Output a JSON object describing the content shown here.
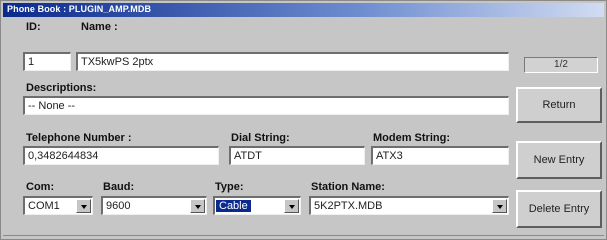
{
  "window": {
    "title": "Phone Book : PLUGIN_AMP.MDB"
  },
  "labels": {
    "id": "ID:",
    "name": "Name :",
    "descriptions": "Descriptions:",
    "telephone": "Telephone Number :",
    "dial": "Dial String:",
    "modem": "Modem String:",
    "com": "Com:",
    "baud": "Baud:",
    "type": "Type:",
    "station": "Station Name:"
  },
  "fields": {
    "id": "1",
    "name": "TX5kwPS 2ptx",
    "descriptions": "-- None --",
    "telephone": "0,3482644834",
    "dial": "ATDT",
    "modem": "ATX3",
    "com": "COM1",
    "baud": "9600",
    "type": "Cable",
    "station": "5K2PTX.MDB"
  },
  "record_counter": "1/2",
  "buttons": {
    "return": "Return",
    "new_entry": "New Entry",
    "delete_entry": "Delete Entry"
  },
  "icons": {
    "dropdown": "chevron-down-icon"
  }
}
